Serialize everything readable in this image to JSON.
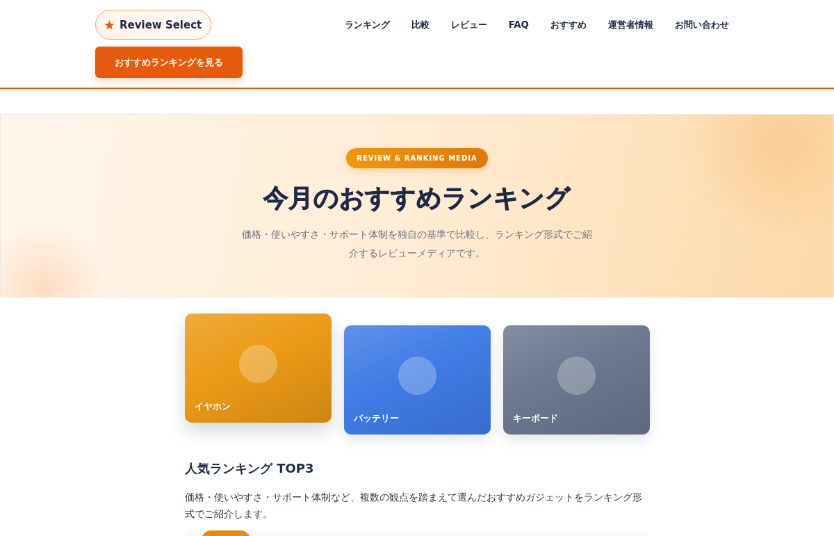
{
  "header": {
    "logo": "Review Select",
    "nav": [
      "ランキング",
      "比較",
      "レビュー",
      "FAQ",
      "おすすめ",
      "運営者情報",
      "お問い合わせ"
    ],
    "cta_button": "おすすめランキングを見る"
  },
  "hero": {
    "badge": "REVIEW & RANKING MEDIA",
    "title": "今月のおすすめランキング",
    "description": "価格・使いやすさ・サポート体制を独自の基準で比較し、ランキング形式でご紹介するレビューメディアです。"
  },
  "categories": [
    {
      "label": "イヤホン",
      "color": "#eb9a16",
      "raised": true
    },
    {
      "label": "バッテリー",
      "color": "#407ce6",
      "raised": false
    },
    {
      "label": "キーボード",
      "color": "#6c788f",
      "raised": false
    }
  ],
  "ranking_section": {
    "title": "人気ランキング TOP3",
    "description": "価格・使いやすさ・サポート体制など、複数の観点を踏まえて選んだおすすめガジェットをランキング形式でご紹介します。"
  }
}
